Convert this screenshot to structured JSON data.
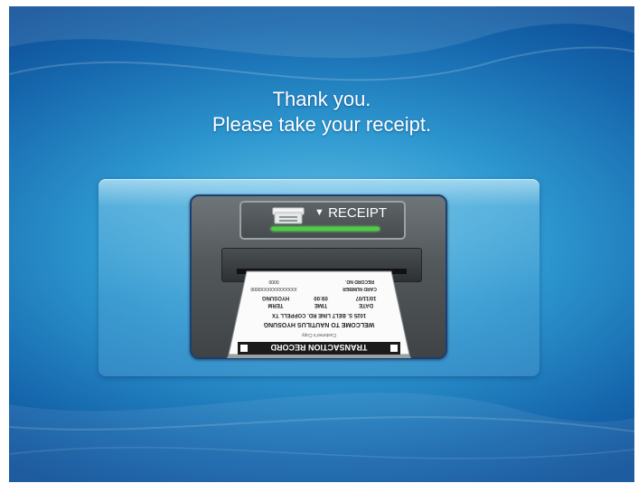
{
  "message": {
    "line1": "Thank you.",
    "line2": "Please take your receipt."
  },
  "receipt_indicator": {
    "label": "RECEIPT",
    "arrow": "▼",
    "icon": "receipt-printer-icon",
    "led_color": "#44d43a"
  },
  "receipt_paper": {
    "header": "TRANSACTION RECORD",
    "subheader": "Customer's Copy",
    "welcome_line": "WELCOME TO NAUTILUS HYOSUNG",
    "address_line": "1025 S. BELT LINE RD. COPPELL TX",
    "row_labels": [
      "DATE",
      "TIME",
      "TERM"
    ],
    "row_values": [
      "10/11/07",
      "09:00",
      "HYOSUNG"
    ],
    "card_label": "CARD NUMBER",
    "card_value": "XXXXXXXXXXXX0000",
    "record_label": "RECORD NO.",
    "record_value": "0000"
  },
  "colors": {
    "background_center": "#6cc7ea",
    "background_edge": "#0d4f98",
    "device_border": "#1c3f73"
  }
}
